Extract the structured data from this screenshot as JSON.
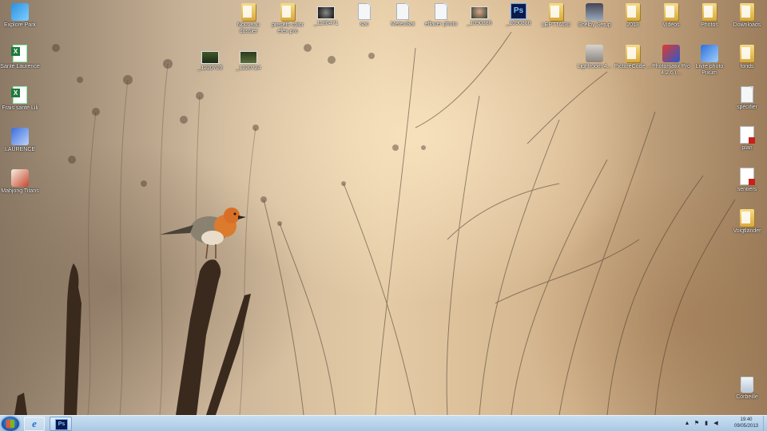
{
  "desktop": {
    "icons": [
      {
        "label": "Explore Park",
        "type": "app"
      },
      {
        "label": "Santé Laurence",
        "type": "excel"
      },
      {
        "label": "Frais santé Lili",
        "type": "excel"
      },
      {
        "label": "LAURENCE",
        "type": "app"
      },
      {
        "label": "Mahjong Titans",
        "type": "app"
      },
      {
        "label": "_1220705",
        "type": "photo"
      },
      {
        "label": "_1220724",
        "type": "photo"
      },
      {
        "label": "Nouveau dossier",
        "type": "folder"
      },
      {
        "label": "presets color efex pro",
        "type": "folder"
      },
      {
        "label": "_1180471",
        "type": "photo"
      },
      {
        "label": "sac",
        "type": "file"
      },
      {
        "label": "MeteoSat",
        "type": "file"
      },
      {
        "label": "effacer photo",
        "type": "file"
      },
      {
        "label": "_1090386",
        "type": "photo"
      },
      {
        "label": "_1090386",
        "type": "photoshop",
        "glyph": "Ps"
      },
      {
        "label": "LEPTTAGU",
        "type": "folder"
      },
      {
        "label": "Shelby Setup",
        "type": "app"
      },
      {
        "label": "2013",
        "type": "folder"
      },
      {
        "label": "Vidéos",
        "type": "folder"
      },
      {
        "label": "Photos",
        "type": "folder"
      },
      {
        "label": "Downloads",
        "type": "folder"
      },
      {
        "label": "Lightroom 4...",
        "type": "app"
      },
      {
        "label": "PictureCode ...",
        "type": "folder"
      },
      {
        "label": "Photomatix Pro 4.2.6 (...",
        "type": "app"
      },
      {
        "label": "Livre photo Pixum",
        "type": "app"
      },
      {
        "label": "fonds",
        "type": "folder"
      },
      {
        "label": "spécifier",
        "type": "file"
      },
      {
        "label": "plan",
        "type": "pdf"
      },
      {
        "label": "sentiers",
        "type": "pdf"
      },
      {
        "label": "Voigtländer",
        "type": "folder"
      },
      {
        "label": "Corbeille",
        "type": "recycle-bin"
      }
    ]
  },
  "taskbar": {
    "start_label": "Start",
    "pinned": [
      {
        "name": "Internet Explorer",
        "glyph": "e"
      },
      {
        "name": "Adobe Photoshop",
        "glyph": "Ps"
      }
    ],
    "clock": {
      "time": "19:40",
      "date": "09/05/2013"
    }
  },
  "colors": {
    "taskbar": "#b6d2ea",
    "icon_label": "#ffffff",
    "wallpaper_light": "#f1dcb6",
    "wallpaper_dark": "#7a6551"
  }
}
